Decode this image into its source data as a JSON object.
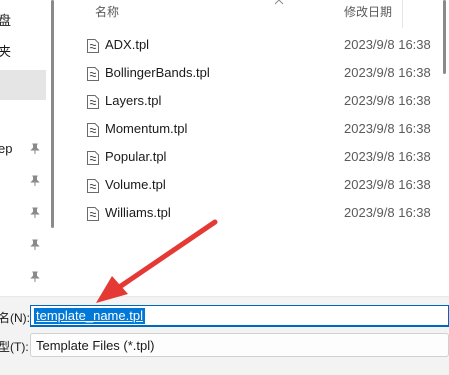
{
  "nav": {
    "items": [
      {
        "label": "盘"
      },
      {
        "label": "夹"
      },
      {
        "label": ""
      },
      {
        "label": "ep",
        "pinned": true
      },
      {
        "label": "",
        "pinned": true
      },
      {
        "label": "",
        "pinned": true
      },
      {
        "label": "",
        "pinned": true
      },
      {
        "label": "",
        "pinned": true
      }
    ]
  },
  "list": {
    "columns": {
      "name": "名称",
      "modified": "修改日期"
    },
    "files": [
      {
        "name": "ADX.tpl",
        "modified": "2023/9/8 16:38",
        "icon": "template-file-icon"
      },
      {
        "name": "BollingerBands.tpl",
        "modified": "2023/9/8 16:38",
        "icon": "template-file-icon"
      },
      {
        "name": "Layers.tpl",
        "modified": "2023/9/8 16:38",
        "icon": "template-file-icon"
      },
      {
        "name": "Momentum.tpl",
        "modified": "2023/9/8 16:38",
        "icon": "template-file-icon"
      },
      {
        "name": "Popular.tpl",
        "modified": "2023/9/8 16:38",
        "icon": "template-file-icon"
      },
      {
        "name": "Volume.tpl",
        "modified": "2023/9/8 16:38",
        "icon": "template-file-icon"
      },
      {
        "name": "Williams.tpl",
        "modified": "2023/9/8 16:38",
        "icon": "template-file-icon"
      }
    ]
  },
  "form": {
    "filename_label": "名(N):",
    "filename_value": "template_name.tpl",
    "filetype_label": "型(T):",
    "filetype_value": "Template Files (*.tpl)"
  },
  "colors": {
    "accent": "#0078d7",
    "annotation_arrow": "#e53935"
  }
}
